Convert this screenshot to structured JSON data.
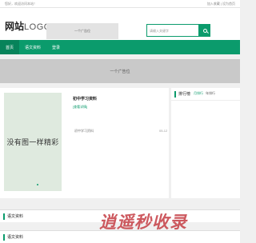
{
  "topbar": {
    "tip": "您好，欢迎访问本站！",
    "favorite": "加入收藏 | 设为首页"
  },
  "header": {
    "logo_cn": "网站",
    "logo_en": "LOGO",
    "ad_text": "一个广告位",
    "search_placeholder": "请输入关键字"
  },
  "nav": {
    "items": [
      "首页",
      "语文资料",
      "登录"
    ],
    "active_index": 0
  },
  "banner": {
    "text": "一个广告位"
  },
  "article": {
    "thumb_text": "没有图一样精彩",
    "title": "初中学习资料",
    "tag": "[查看详情]",
    "subitem": "初中学习资料",
    "date": "05-12"
  },
  "sidebar": {
    "title": "排行榜",
    "tabs": [
      "月排行",
      "年排行"
    ]
  },
  "sections": [
    {
      "title": "语文资料"
    },
    {
      "title": "语文资料"
    }
  ],
  "watermark": "逍遥秒收录",
  "colors": {
    "accent": "#0b9b6c",
    "watermark": "#c8484e"
  }
}
